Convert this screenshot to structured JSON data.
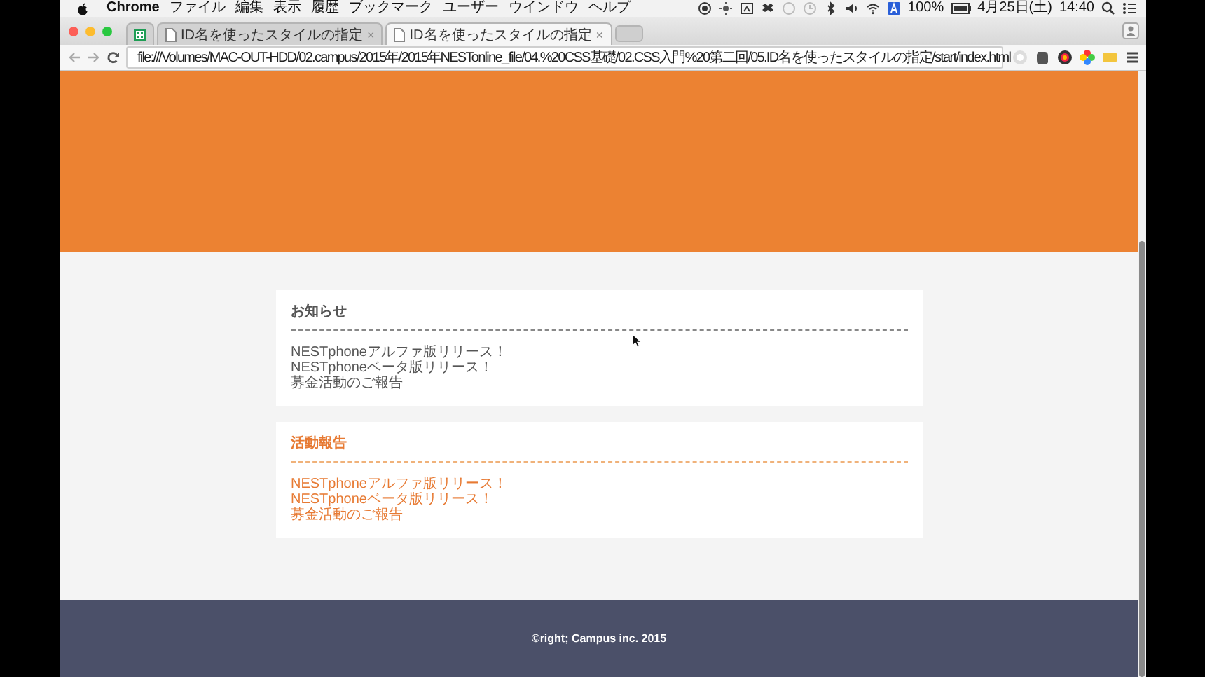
{
  "menu_bar": {
    "app": "Chrome",
    "menus": [
      "ファイル",
      "編集",
      "表示",
      "履歴",
      "ブックマーク",
      "ユーザー",
      "ウインドウ",
      "ヘルプ"
    ],
    "battery": "100%",
    "date": "4月25日(土)",
    "time": "14:40"
  },
  "tabs": [
    {
      "title": "ID名を使ったスタイルの指定",
      "close": "×",
      "selected": false
    },
    {
      "title": "ID名を使ったスタイルの指定",
      "close": "×",
      "selected": true
    }
  ],
  "address_bar": {
    "url": "file:///Volumes/MAC-OUT-HDD/02.campus/2015年/2015年NESTonline_file/04.%20CSS基礎/02.CSS入門%20第二回/05.ID名を使ったスタイルの指定/start/index.html"
  },
  "page": {
    "sections": [
      {
        "kind": "plain",
        "title": "お知らせ",
        "items": [
          "NESTphoneアルファ版リリース！",
          "NESTphoneベータ版リリース！",
          "募金活動のご報告"
        ]
      },
      {
        "kind": "accent",
        "title": "活動報告",
        "items": [
          "NESTphoneアルファ版リリース！",
          "NESTphoneベータ版リリース！",
          "募金活動のご報告"
        ]
      }
    ],
    "footer": "©right; Campus inc. 2015"
  }
}
